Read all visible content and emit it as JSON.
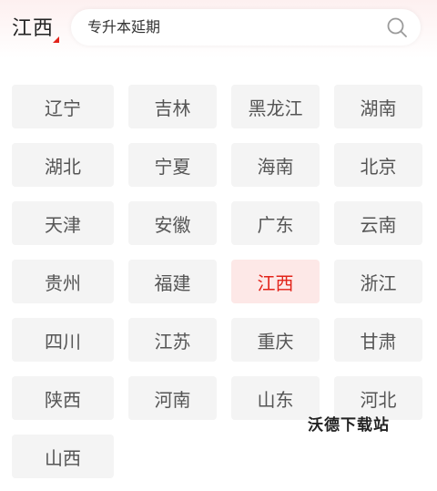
{
  "header": {
    "region_label": "江西",
    "search_text": "专升本延期"
  },
  "provinces": [
    "辽宁",
    "吉林",
    "黑龙江",
    "湖南",
    "湖北",
    "宁夏",
    "海南",
    "北京",
    "天津",
    "安徽",
    "广东",
    "云南",
    "贵州",
    "福建",
    "江西",
    "浙江",
    "四川",
    "江苏",
    "重庆",
    "甘肃",
    "陕西",
    "河南",
    "山东",
    "河北",
    "山西"
  ],
  "selected_province": "江西",
  "watermark": "沃德下载站",
  "colors": {
    "accent": "#e2231a",
    "active_bg": "#fde8e7",
    "cell_bg": "#f4f4f4"
  }
}
